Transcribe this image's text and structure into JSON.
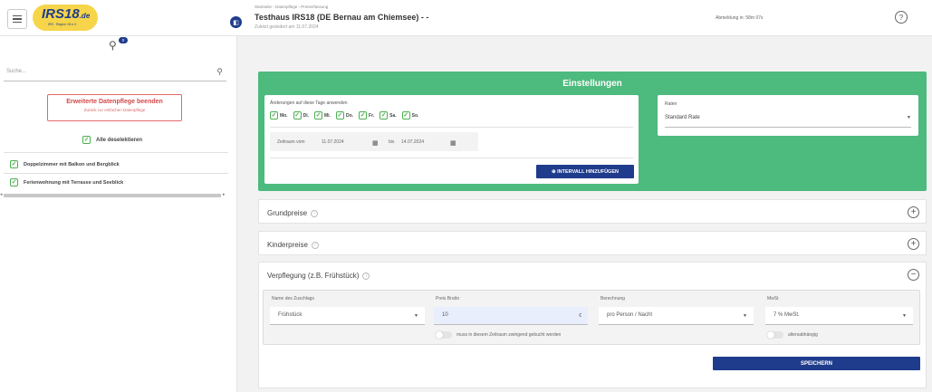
{
  "header": {
    "logo_text": "IRS18",
    "logo_suffix": ".de",
    "logo_tagline": "IRS · Region 18 e.V.",
    "breadcrumb": "Startseite  ›  Datenpflege  ›  Preiserfassung",
    "title": "Testhaus IRS18 (DE Bernau am Chiemsee) - -",
    "subtitle": "Zuletzt geändert am 11.07.2024",
    "logout_text": "Abmeldung in: 58m 07s",
    "help_label": "?"
  },
  "sidebar": {
    "badge": "0",
    "search_placeholder": "Suche...",
    "extended_button": {
      "title": "Erweiterte Datenpflege beenden",
      "sub": "Zurück zur einfachen Datenpflege"
    },
    "deselect_label": "Alle deselektieren",
    "rooms": [
      "Doppelzimmer mit Balkon und Bergblick",
      "Ferienwohnung mit Terrasse und Seeblick"
    ]
  },
  "settings": {
    "title": "Einstellungen",
    "apply_label": "Änderungen auf diese Tage anwenden",
    "days": [
      "Mo.",
      "Di.",
      "Mi.",
      "Do.",
      "Fr.",
      "Sa.",
      "So."
    ],
    "period_from_label": "Zeitraum vom",
    "date_from": "11.07.2024",
    "to_label": "bis",
    "date_to": "14.07.2024",
    "add_interval": "⊕ INTERVALL HINZUFÜGEN",
    "rates_label": "Raten",
    "rate_value": "Standard Rate"
  },
  "accordions": {
    "grundpreise": "Grundpreise",
    "kinderpreise": "Kinderpreise",
    "verpflegung": "Verpflegung (z.B. Frühstück)"
  },
  "form": {
    "name_label": "Name des Zuschlags",
    "name_value": "Frühstück",
    "price_label": "Preis Brutto",
    "price_value": "10",
    "currency": "€",
    "calc_label": "Berechnung",
    "calc_value": "pro Person / Nacht",
    "vat_label": "MwSt",
    "vat_value": "7 % MwSt.",
    "mandatory_label": "muss in diesem Zeitraum zwingend gebucht werden",
    "age_label": "altersabhängig",
    "save_label": "SPEICHERN"
  }
}
